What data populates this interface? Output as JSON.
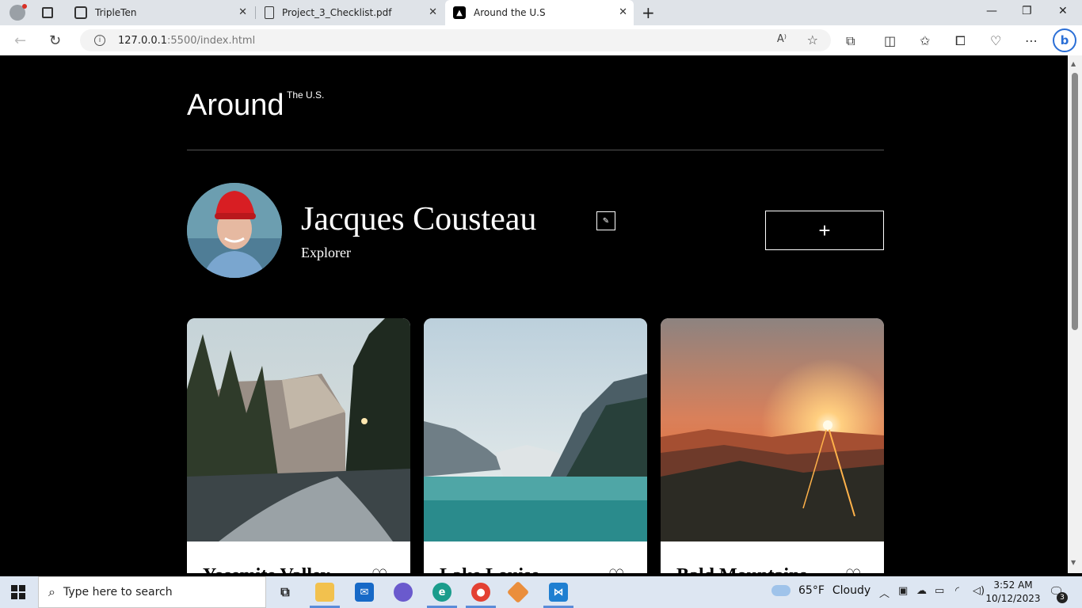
{
  "browser": {
    "tabs": [
      {
        "label": "TripleTen"
      },
      {
        "label": "Project_3_Checklist.pdf"
      },
      {
        "label": "Around the U.S"
      }
    ],
    "new_tab_label": "+",
    "url_host": "127.0.0.1",
    "url_rest": ":5500/index.html"
  },
  "header": {
    "logo": "Around",
    "logo_sup": "The U.S."
  },
  "profile": {
    "name": "Jacques Cousteau",
    "job": "Explorer",
    "edit_icon": "pencil-icon",
    "add_label": "+"
  },
  "cards": [
    {
      "title": "Yosemite Valley",
      "heart": "♡"
    },
    {
      "title": "Lake Louise",
      "heart": "♡"
    },
    {
      "title": "Bald Mountains",
      "heart": "♡"
    }
  ],
  "taskbar": {
    "search_placeholder": "Type here to search",
    "weather_temp": "65°F",
    "weather_desc": "Cloudy",
    "time": "3:52 AM",
    "date": "10/12/2023",
    "notif_count": "3"
  },
  "colors": {
    "page_bg": "#000000",
    "card_bg": "#ffffff",
    "taskbar_bg": "#dde6f2"
  }
}
